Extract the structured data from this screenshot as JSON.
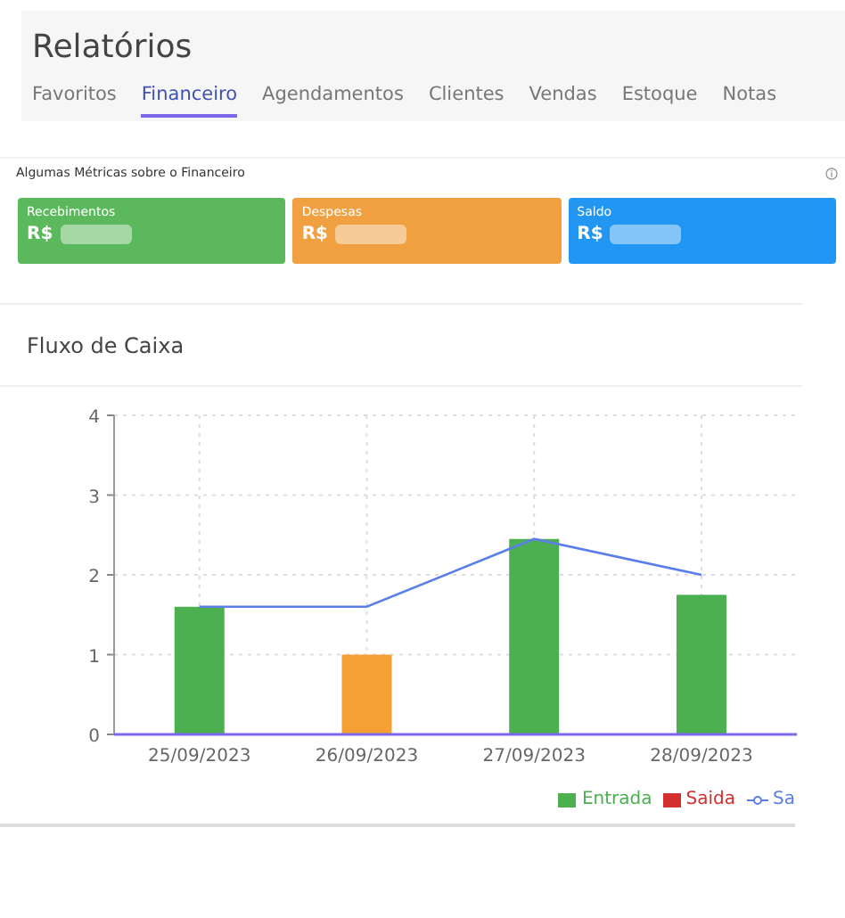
{
  "header": {
    "title": "Relatórios"
  },
  "tabs": [
    {
      "label": "Favoritos",
      "selected": false
    },
    {
      "label": "Financeiro",
      "selected": true
    },
    {
      "label": "Agendamentos",
      "selected": false
    },
    {
      "label": "Clientes",
      "selected": false
    },
    {
      "label": "Vendas",
      "selected": false
    },
    {
      "label": "Estoque",
      "selected": false
    },
    {
      "label": "Notas",
      "selected": false
    }
  ],
  "metrics": {
    "caption": "Algumas Métricas sobre o Financeiro",
    "cards": [
      {
        "label": "Recebimentos",
        "currency": "R$",
        "color": "#5cb85c"
      },
      {
        "label": "Despesas",
        "currency": "R$",
        "color": "#f0a040"
      },
      {
        "label": "Saldo",
        "currency": "R$",
        "color": "#2196f3"
      }
    ]
  },
  "cash_flow": {
    "title": "Fluxo de Caixa",
    "chart_data": {
      "type": "bar",
      "categories": [
        "25/09/2023",
        "26/09/2023",
        "27/09/2023",
        "28/09/2023"
      ],
      "ylim": [
        0,
        4
      ],
      "yticks": [
        0,
        1,
        2,
        3,
        4
      ],
      "grid": true,
      "legend": "bottom-right",
      "series": [
        {
          "name": "Entrada",
          "color": "#4caf50",
          "values": [
            1.6,
            null,
            2.45,
            1.75
          ]
        },
        {
          "name": "Saida",
          "color": "#d32f2f",
          "values": [
            null,
            null,
            null,
            null
          ]
        },
        {
          "name": "Sa",
          "type": "line",
          "color": "#5b7fe8",
          "values": [
            1.6,
            1.6,
            2.45,
            2.0
          ]
        },
        {
          "color": "#f5a033",
          "values": [
            null,
            1,
            null,
            null
          ]
        }
      ]
    }
  }
}
